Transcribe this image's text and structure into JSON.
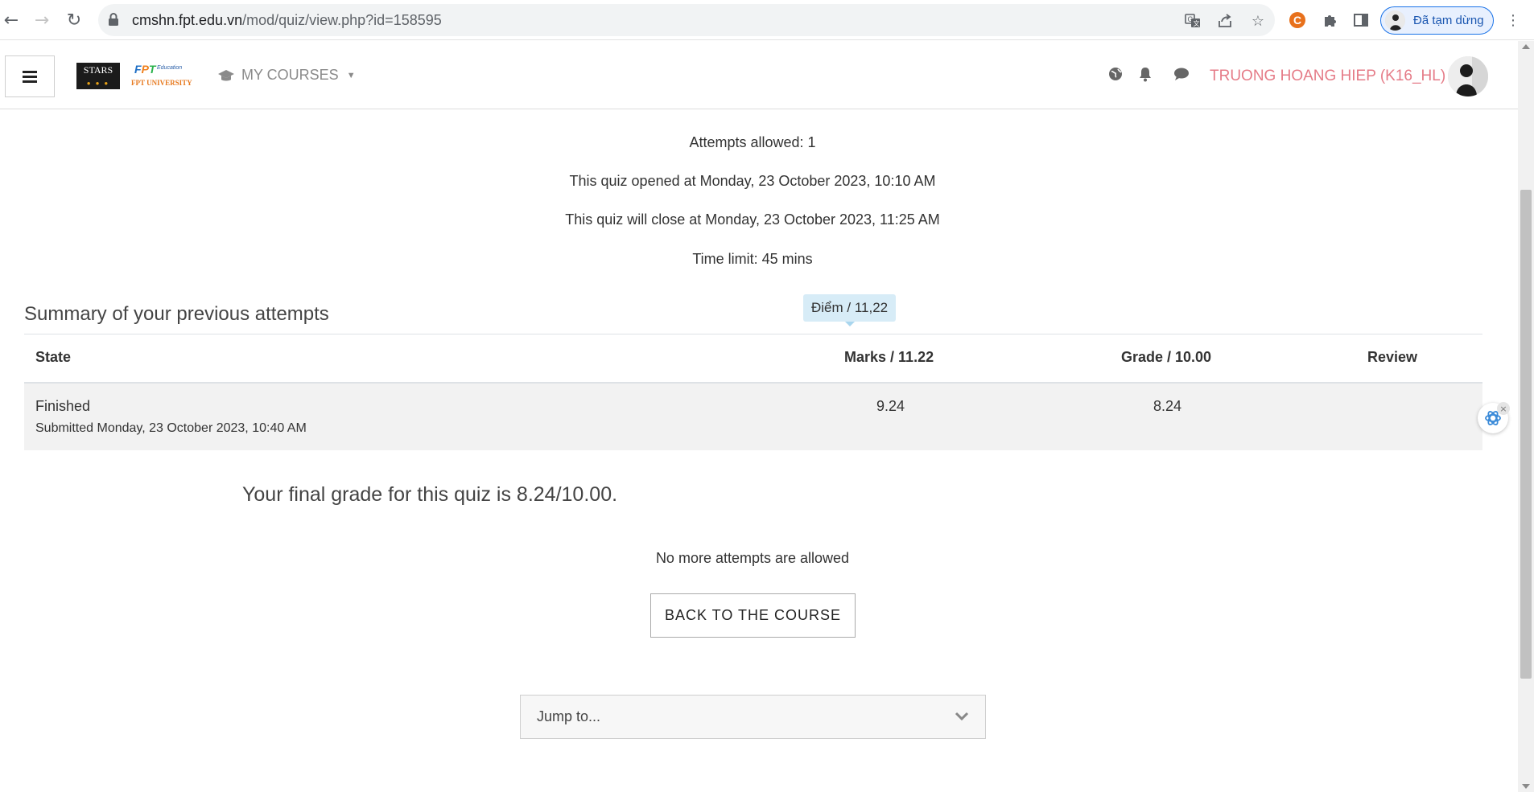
{
  "browser": {
    "url_host": "cmshn.fpt.edu.vn",
    "url_path": "/mod/quiz/view.php?id=158595",
    "profile_label": "Đã tạm dừng",
    "icons": [
      "back-icon",
      "forward-icon",
      "reload-icon",
      "lock-icon",
      "translate-icon",
      "share-icon",
      "star-icon",
      "extension-c-icon",
      "puzzle-icon",
      "side-panel-icon",
      "kebab-menu-icon"
    ]
  },
  "header": {
    "logo_stars": "STARS",
    "logo_fpt": "FPT",
    "logo_edu": "Education",
    "logo_university": "FPT UNIVERSITY",
    "my_courses": "MY COURSES",
    "username": "TRUONG HOANG HIEP (K16_HL)",
    "username_color": "#e57b87"
  },
  "quiz_info": {
    "attempts_allowed": "Attempts allowed: 1",
    "opened": "This quiz opened at Monday, 23 October 2023, 10:10 AM",
    "closes": "This quiz will close at Monday, 23 October 2023, 11:25 AM",
    "time_limit": "Time limit: 45 mins"
  },
  "summary": {
    "title": "Summary of your previous attempts",
    "tooltip": "Điểm / 11,22",
    "columns": {
      "state": "State",
      "marks": "Marks / 11.22",
      "grade": "Grade / 10.00",
      "review": "Review"
    },
    "rows": [
      {
        "state": "Finished",
        "submitted": "Submitted Monday, 23 October 2023, 10:40 AM",
        "marks": "9.24",
        "grade": "8.24",
        "review": ""
      }
    ]
  },
  "final_grade": "Your final grade for this quiz is 8.24/10.00.",
  "no_more_attempts": "No more attempts are allowed",
  "back_button": "BACK TO THE COURSE",
  "jump_to": "Jump to..."
}
